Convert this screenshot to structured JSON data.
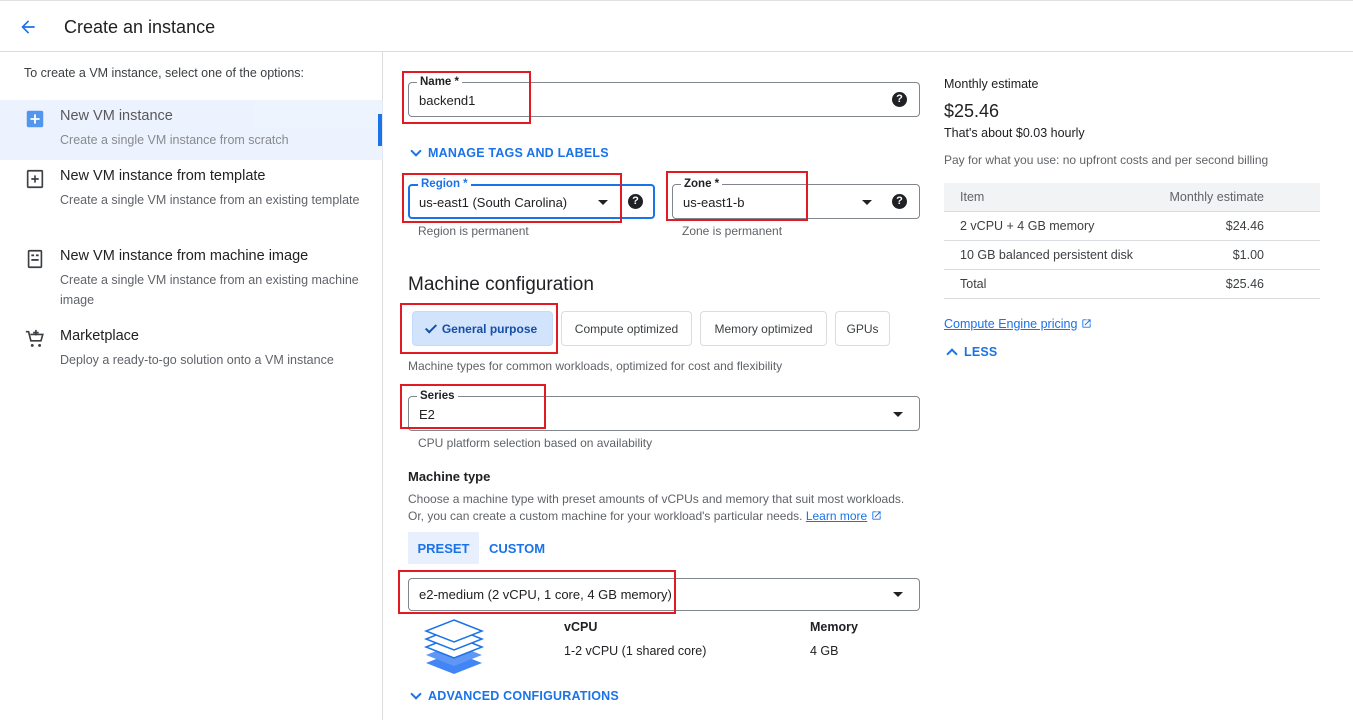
{
  "header": {
    "title": "Create an instance"
  },
  "sidebar": {
    "intro": "To create a VM instance, select one of the options:",
    "options": [
      {
        "title": "New VM instance",
        "desc": "Create a single VM instance from scratch",
        "icon": "add-box-icon",
        "selected": true
      },
      {
        "title": "New VM instance from template",
        "desc": "Create a single VM instance from an existing template",
        "icon": "template-add-icon"
      },
      {
        "title": "New VM instance from machine image",
        "desc": "Create a single VM instance from an existing machine image",
        "icon": "machine-image-icon"
      },
      {
        "title": "Marketplace",
        "desc": "Deploy a ready-to-go solution onto a VM instance",
        "icon": "cart-icon"
      }
    ]
  },
  "form": {
    "name_label": "Name *",
    "name_value": "backend1",
    "manage_tags": "MANAGE TAGS AND LABELS",
    "region_label": "Region *",
    "region_value": "us-east1 (South Carolina)",
    "region_hint": "Region is permanent",
    "zone_label": "Zone *",
    "zone_value": "us-east1-b",
    "zone_hint": "Zone is permanent"
  },
  "machine": {
    "section_title": "Machine configuration",
    "chips": [
      "General purpose",
      "Compute optimized",
      "Memory optimized",
      "GPUs"
    ],
    "chips_desc": "Machine types for common workloads, optimized for cost and flexibility",
    "series_label": "Series",
    "series_value": "E2",
    "series_hint": "CPU platform selection based on availability",
    "type_title": "Machine type",
    "type_desc_1": "Choose a machine type with preset amounts of vCPUs and memory that suit most workloads.",
    "type_desc_2": "Or, you can create a custom machine for your workload's particular needs.",
    "learn_more": "Learn more",
    "tabs": [
      "PRESET",
      "CUSTOM"
    ],
    "type_value": "e2-medium (2 vCPU, 1 core, 4 GB memory)",
    "vcpu_header": "vCPU",
    "vcpu_value": "1-2 vCPU (1 shared core)",
    "memory_header": "Memory",
    "memory_value": "4 GB",
    "advanced": "ADVANCED CONFIGURATIONS"
  },
  "estimate": {
    "title": "Monthly estimate",
    "price": "$25.46",
    "hourly": "That's about $0.03 hourly",
    "note": "Pay for what you use: no upfront costs and per second billing",
    "table_head": [
      "Item",
      "Monthly estimate"
    ],
    "rows": [
      [
        "2 vCPU + 4 GB memory",
        "$24.46"
      ],
      [
        "10 GB balanced persistent disk",
        "$1.00"
      ],
      [
        "Total",
        "$25.46"
      ]
    ],
    "pricing_link": "Compute Engine pricing",
    "less": "LESS"
  },
  "colors": {
    "accent": "#1a73e8",
    "highlight": "#e01b24"
  }
}
